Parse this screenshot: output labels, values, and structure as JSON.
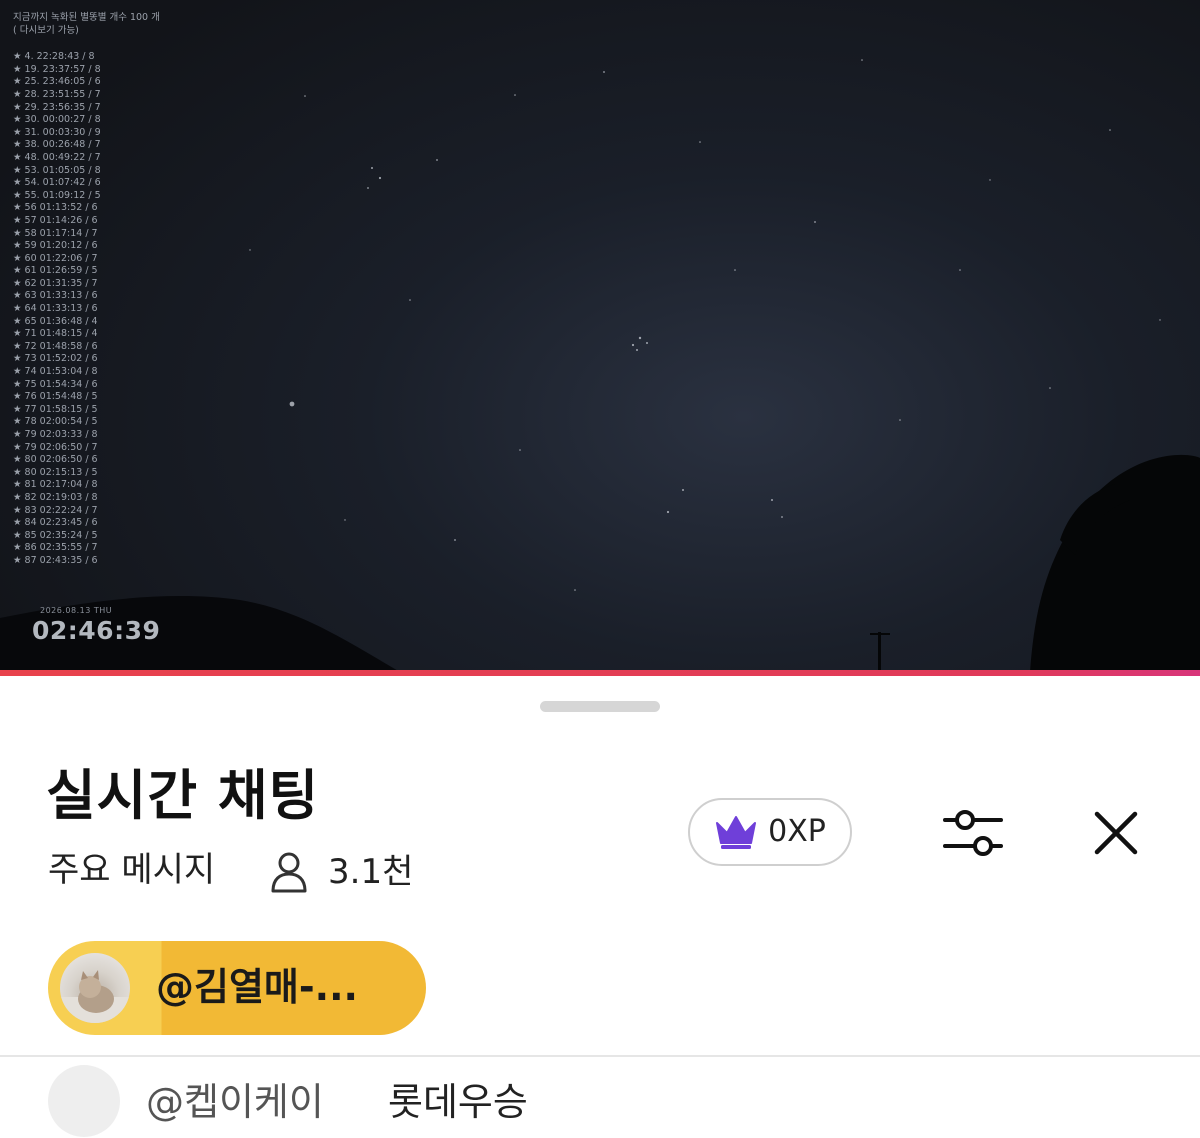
{
  "video": {
    "overlay_title": "지금까지 녹화된 별똥별 개수 100 개 ( 다시보기 가능)",
    "meteor_log": [
      "★ 4. 22:28:43 / 8",
      "★ 19. 23:37:57 / 8",
      "★ 25. 23:46:05 / 6",
      "★ 28. 23:51:55 / 7",
      "★ 29. 23:56:35 / 7",
      "★ 30. 00:00:27 / 8",
      "★ 31. 00:03:30 / 9",
      "★ 38. 00:26:48 / 7",
      "★ 48. 00:49:22 / 7",
      "★ 53. 01:05:05 / 8",
      "★ 54. 01:07:42 / 6",
      "★ 55. 01:09:12 / 5",
      "★ 56 01:13:52 / 6",
      "★ 57 01:14:26 / 6",
      "★ 58 01:17:14 / 7",
      "★ 59 01:20:12 / 6",
      "★ 60 01:22:06 / 7",
      "★ 61 01:26:59 / 5",
      "★ 62 01:31:35 / 7",
      "★ 63 01:33:13 / 6",
      "★ 64 01:33:13 / 6",
      "★ 65 01:36:48 / 4",
      "★ 71 01:48:15 / 4",
      "★ 72 01:48:58 / 6",
      "★ 73 01:52:02 / 6",
      "★ 74 01:53:04 / 8",
      "★ 75 01:54:34 / 6",
      "★ 76 01:54:48 / 5",
      "★ 77 01:58:15 / 5",
      "★ 78 02:00:54 / 5",
      "★ 79 02:03:33 / 8",
      "★ 79 02:06:50 / 7",
      "★ 80 02:06:50 / 6",
      "★ 80 02:15:13 / 5",
      "★ 81 02:17:04 / 8",
      "★ 82 02:19:03 / 8",
      "★ 83 02:22:24 / 7",
      "★ 84 02:23:45 / 6",
      "★ 85 02:35:24 / 5",
      "★ 86 02:35:55 / 7",
      "★ 87 02:43:35 / 6"
    ],
    "clock_date": "2026.08.13 THU",
    "clock_time": "02:46:39",
    "progress_fraction": 1.0,
    "progress_color": "#e8424c"
  },
  "chat": {
    "title": "실시간 채팅",
    "filter_label": "주요 메시지",
    "viewer_count": "3.1천",
    "viewer_icon": "person-icon",
    "xp_label": "0XP",
    "xp_icon": "crown-icon",
    "xp_icon_color": "#6f3fd9",
    "settings_icon": "sliders-icon",
    "close_icon": "close-icon",
    "pinned": {
      "name": "@김열매-...",
      "background_color": "#f2b935"
    },
    "messages": [
      {
        "author": "@켑이케이",
        "text": "롯데우승"
      }
    ]
  }
}
